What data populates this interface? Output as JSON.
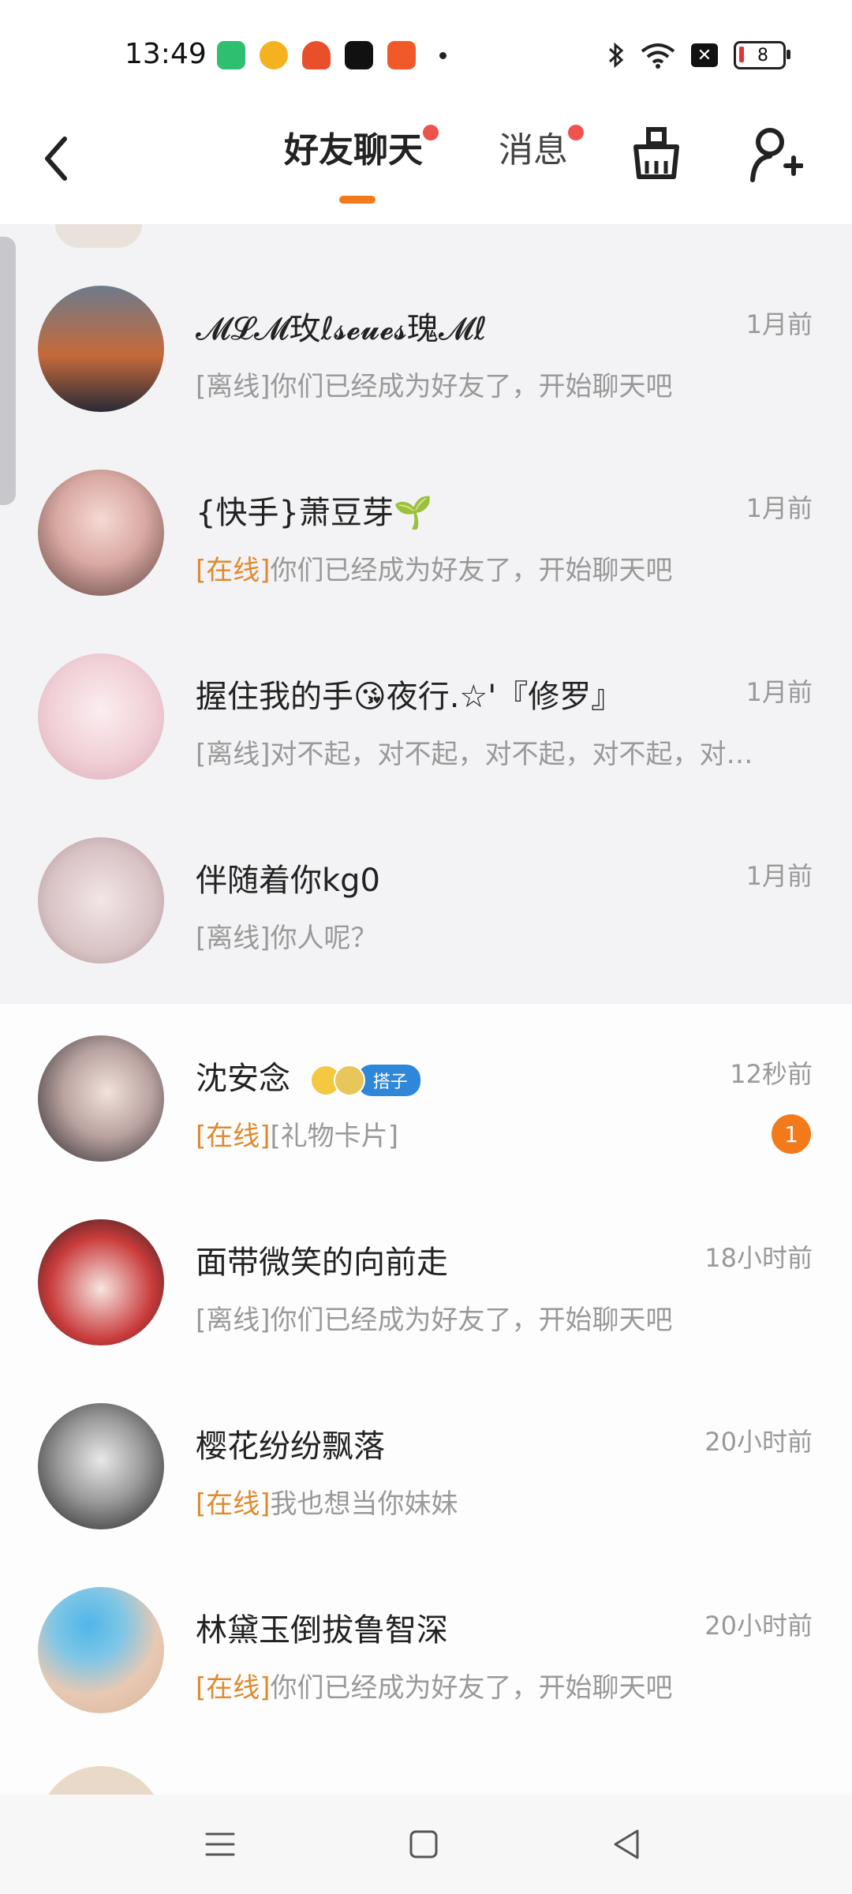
{
  "status_bar": {
    "time": "13:49",
    "battery_level": "8"
  },
  "header": {
    "tabs": [
      {
        "label": "好友聊天",
        "active": true,
        "has_dot": true
      },
      {
        "label": "消息",
        "active": false,
        "has_dot": true
      }
    ]
  },
  "chats": [
    {
      "name": "𝓜𝓛𝓜玫ℓ𝓼𝓮𝓾𝓮𝓼瑰𝓜ℓ",
      "time": "1月前",
      "status": "[离线]",
      "preview": "你们已经成为好友了，开始聊天吧",
      "online": false
    },
    {
      "name": "{快手}萧豆芽🌱",
      "time": "1月前",
      "status": "[在线]",
      "preview": "你们已经成为好友了，开始聊天吧",
      "online": true
    },
    {
      "name": "握住我的手😘夜行.☆'『修罗』",
      "time": "1月前",
      "status": "[离线]",
      "preview": "对不起，对不起，对不起，对不起，对…",
      "online": false
    },
    {
      "name": "伴随着你kg0",
      "time": "1月前",
      "status": "[离线]",
      "preview": "你人呢？",
      "online": false
    },
    {
      "name": "沈安念",
      "time": "12秒前",
      "status": "[在线]",
      "preview": "[礼物卡片]",
      "online": true,
      "tag": "搭子",
      "unread": "1"
    },
    {
      "name": "面带微笑的向前走",
      "time": "18小时前",
      "status": "[离线]",
      "preview": "你们已经成为好友了，开始聊天吧",
      "online": false
    },
    {
      "name": "樱花纷纷飘落",
      "time": "20小时前",
      "status": "[在线]",
      "preview": "我也想当你妹妹",
      "online": true
    },
    {
      "name": "林黛玉倒拔鲁智深",
      "time": "20小时前",
      "status": "[在线]",
      "preview": "你们已经成为好友了，开始聊天吧",
      "online": true
    }
  ],
  "colors": {
    "accent": "#f27a1a",
    "online": "#e0892e",
    "red_dot": "#f0534e",
    "tag_blue": "#2f87d9"
  },
  "icons": [
    "back-arrow-icon",
    "clean-basket-icon",
    "add-user-icon",
    "menu-icon",
    "home-icon",
    "back-triangle-icon"
  ]
}
